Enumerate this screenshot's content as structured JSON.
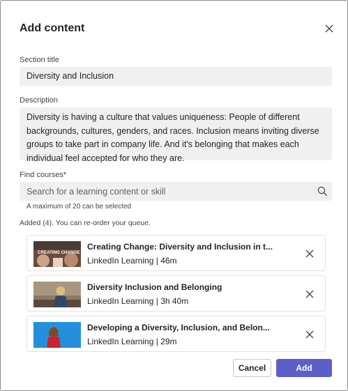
{
  "dialog": {
    "title": "Add content"
  },
  "section_title": {
    "label": "Section title",
    "value": "Diversity and Inclusion"
  },
  "description": {
    "label": "Description",
    "value": "Diversity is having a culture that values uniqueness: People of different backgrounds, cultures, genders, and races. Inclusion means inviting diverse groups to take part in company life. And it's belonging that makes each individual feel accepted for who they are."
  },
  "find_courses": {
    "label": "Find courses*",
    "placeholder": "Search for a learning content or skill",
    "hint": "A maximum of 20 can be selected"
  },
  "added_note": "Added (4). You can re-order your queue.",
  "courses": [
    {
      "title": "Creating Change: Diversity and Inclusion in t...",
      "meta": "LinkedIn Learning | 46m",
      "thumb_text": "CREATING CHANGE"
    },
    {
      "title": "Diversity Inclusion and Belonging",
      "meta": "LinkedIn Learning | 3h 40m"
    },
    {
      "title": "Developing a Diversity, Inclusion, and Belon...",
      "meta": "LinkedIn Learning | 29m"
    }
  ],
  "actions": {
    "cancel": "Cancel",
    "add": "Add"
  },
  "colors": {
    "accent": "#5b5fc7",
    "field_bg": "#f0f0f0"
  }
}
